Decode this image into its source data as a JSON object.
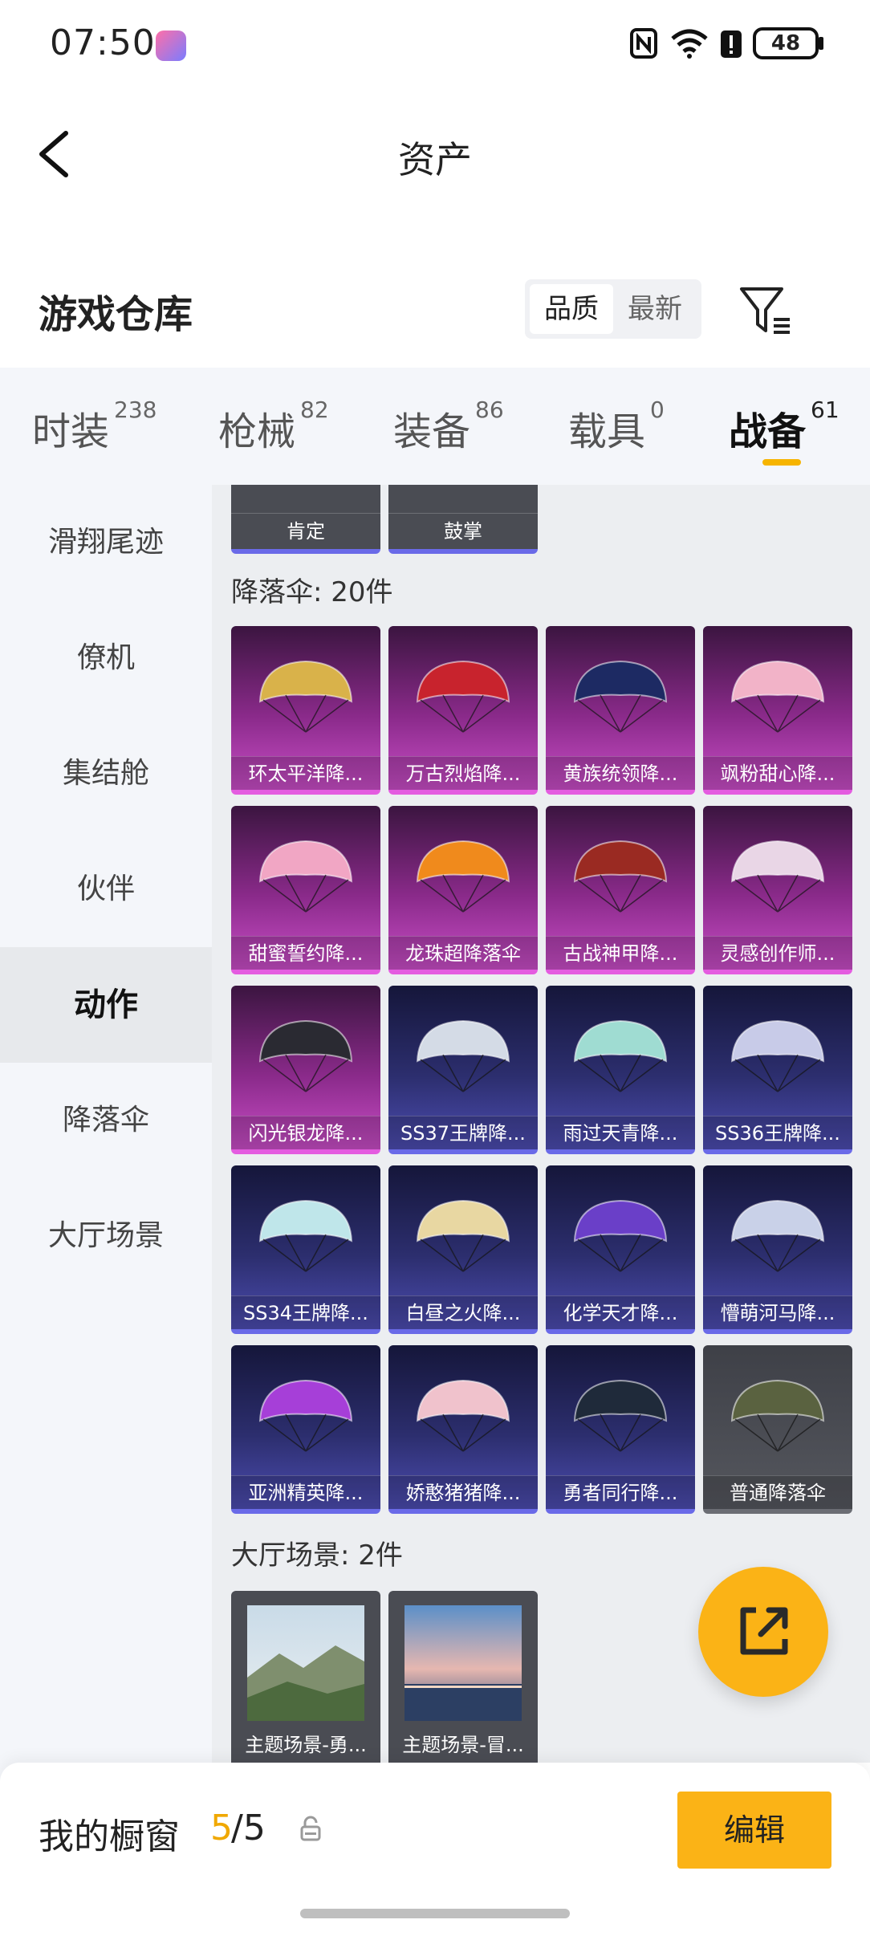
{
  "status": {
    "time": "07:50",
    "battery": "48"
  },
  "header": {
    "title": "资产"
  },
  "section": {
    "title": "游戏仓库",
    "sort_options": [
      "品质",
      "最新"
    ]
  },
  "tabs": [
    {
      "label": "时装",
      "count": "238"
    },
    {
      "label": "枪械",
      "count": "82"
    },
    {
      "label": "装备",
      "count": "86"
    },
    {
      "label": "载具",
      "count": "0"
    },
    {
      "label": "战备",
      "count": "61"
    }
  ],
  "sidebar": [
    "滑翔尾迹",
    "僚机",
    "集结舱",
    "伙伴",
    "动作",
    "降落伞",
    "大厅场景"
  ],
  "actions_tail": [
    "肯定",
    "鼓掌"
  ],
  "parachutes": {
    "label": "降落伞: 20件",
    "items": [
      {
        "name": "环太平洋降...",
        "rarity": "pink",
        "color": "#d9b24a"
      },
      {
        "name": "万古烈焰降...",
        "rarity": "pink",
        "color": "#c8232d"
      },
      {
        "name": "黄族统领降...",
        "rarity": "pink",
        "color": "#1d2a63"
      },
      {
        "name": "飒粉甜心降...",
        "rarity": "pink",
        "color": "#f2b3c8"
      },
      {
        "name": "甜蜜誓约降...",
        "rarity": "pink",
        "color": "#f1a6c4"
      },
      {
        "name": "龙珠超降落伞",
        "rarity": "pink",
        "color": "#f08a1c"
      },
      {
        "name": "古战神甲降...",
        "rarity": "pink",
        "color": "#9a2a22"
      },
      {
        "name": "灵感创作师...",
        "rarity": "pink",
        "color": "#e9d6e6"
      },
      {
        "name": "闪光银龙降...",
        "rarity": "pink",
        "color": "#2a2a32"
      },
      {
        "name": "SS37王牌降...",
        "rarity": "blue",
        "color": "#d4dbe6"
      },
      {
        "name": "雨过天青降...",
        "rarity": "blue",
        "color": "#9fdcd2"
      },
      {
        "name": "SS36王牌降...",
        "rarity": "blue",
        "color": "#c8cbe8"
      },
      {
        "name": "SS34王牌降...",
        "rarity": "blue",
        "color": "#bfe6ea"
      },
      {
        "name": "白昼之火降...",
        "rarity": "blue",
        "color": "#e8d7a2"
      },
      {
        "name": "化学天才降...",
        "rarity": "blue",
        "color": "#6a3fc8"
      },
      {
        "name": "懵萌河马降...",
        "rarity": "blue",
        "color": "#c9d1e8"
      },
      {
        "name": "亚洲精英降...",
        "rarity": "blue",
        "color": "#a63fd8"
      },
      {
        "name": "娇憨猪猪降...",
        "rarity": "blue",
        "color": "#f0c2cc"
      },
      {
        "name": "勇者同行降...",
        "rarity": "blue",
        "color": "#1f2a3a"
      },
      {
        "name": "普通降落伞",
        "rarity": "grey",
        "color": "#5a6240"
      }
    ]
  },
  "lobby": {
    "label": "大厅场景: 2件",
    "items": [
      "主题场景-勇...",
      "主题场景-冒..."
    ]
  },
  "bottom": {
    "showcase": "我的橱窗",
    "count_used": "5",
    "count_total": "/5",
    "edit": "编辑"
  },
  "colors": {
    "accent": "#fbb316"
  }
}
